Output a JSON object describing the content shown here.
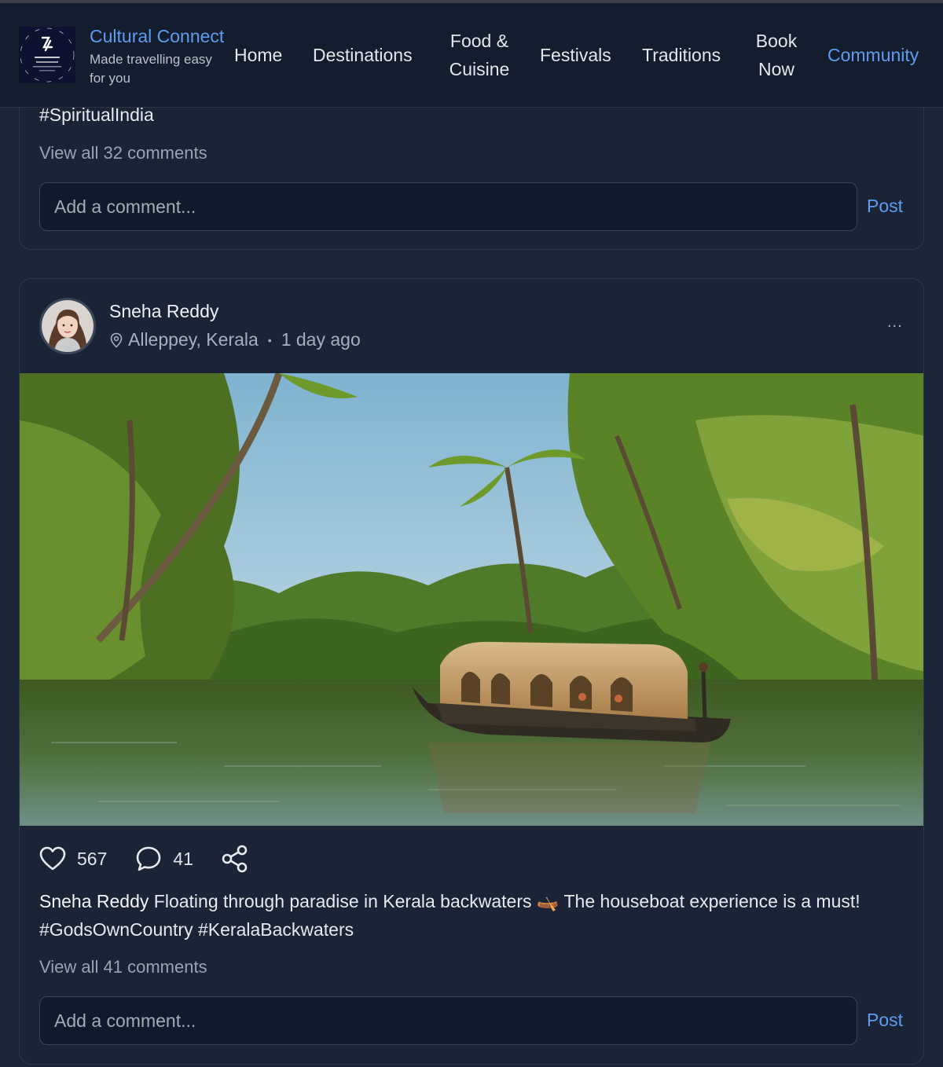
{
  "brand": {
    "title": "Cultural Connect",
    "tagline": "Made travelling easy for you",
    "logo_text": "CULTURAL CONNECT"
  },
  "nav": {
    "items": [
      {
        "label": "Home"
      },
      {
        "label": "Destinations"
      },
      {
        "label": "Food & Cuisine"
      },
      {
        "label": "Festivals"
      },
      {
        "label": "Traditions"
      },
      {
        "label": "Book Now"
      },
      {
        "label": "Community",
        "active": true
      }
    ]
  },
  "previous_post": {
    "hashtags": "#SpiritualIndia",
    "view_comments": "View all 32 comments",
    "comment_placeholder": "Add a comment...",
    "post_label": "Post"
  },
  "post": {
    "author": "Sneha Reddy",
    "location": "Alleppey, Kerala",
    "separator": "•",
    "time": "1 day ago",
    "more": "...",
    "image_alt": "Houseboat cruising through palm-lined Kerala backwaters",
    "likes": "567",
    "comments": "41",
    "caption_author": "Sneha Reddy",
    "caption_text": "Floating through paradise in Kerala backwaters 🛶 The houseboat experience is a must! #GodsOwnCountry #KeralaBackwaters",
    "view_comments": "View all 41 comments",
    "comment_placeholder": "Add a comment...",
    "post_label": "Post"
  },
  "colors": {
    "accent": "#5d9cf0",
    "page_bg": "#1b2538",
    "card_bg": "#1a2436",
    "navbar_bg": "#141d2d"
  },
  "icons": {
    "like": "heart-icon",
    "comment": "speech-bubble-icon",
    "share": "share-icon",
    "location": "map-pin-icon",
    "more": "ellipsis-icon"
  }
}
